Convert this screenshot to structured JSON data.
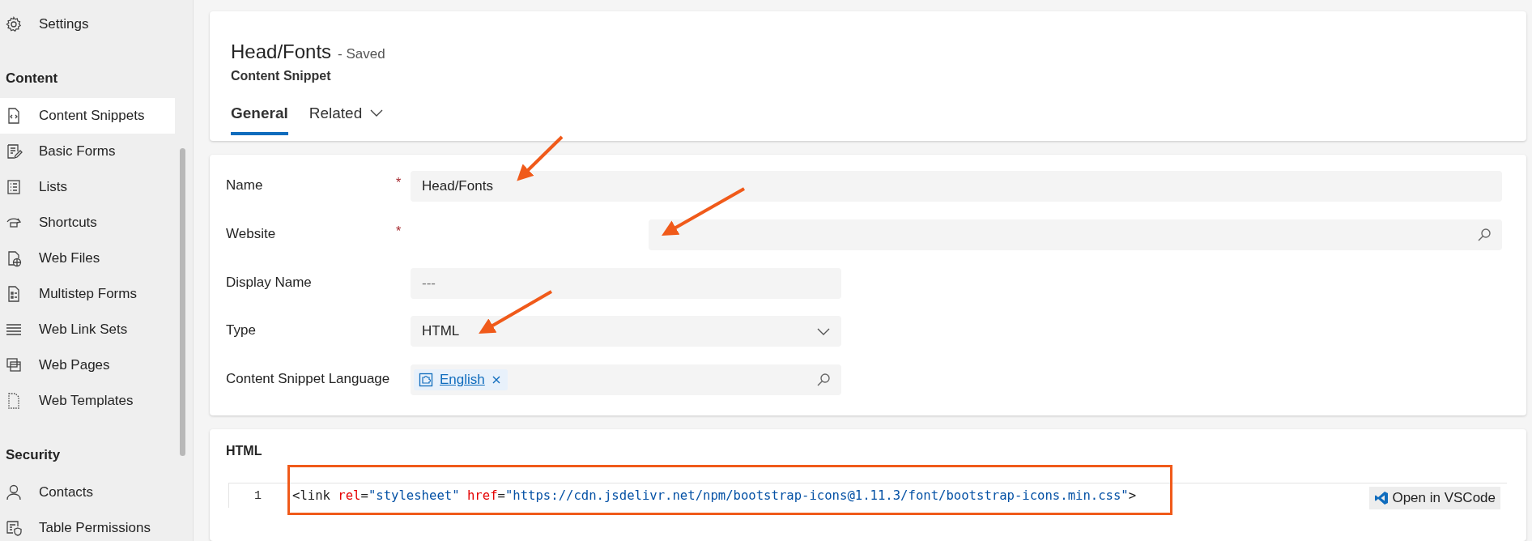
{
  "sidebar": {
    "items": [
      {
        "kind": "item",
        "label": "Settings",
        "selected": false
      },
      {
        "kind": "header",
        "label": "Content"
      },
      {
        "kind": "item",
        "label": "Content Snippets",
        "selected": true
      },
      {
        "kind": "item",
        "label": "Basic Forms",
        "selected": false
      },
      {
        "kind": "item",
        "label": "Lists",
        "selected": false
      },
      {
        "kind": "item",
        "label": "Shortcuts",
        "selected": false
      },
      {
        "kind": "item",
        "label": "Web Files",
        "selected": false
      },
      {
        "kind": "item",
        "label": "Multistep Forms",
        "selected": false
      },
      {
        "kind": "item",
        "label": "Web Link Sets",
        "selected": false
      },
      {
        "kind": "item",
        "label": "Web Pages",
        "selected": false
      },
      {
        "kind": "item",
        "label": "Web Templates",
        "selected": false
      },
      {
        "kind": "header",
        "label": "Security"
      },
      {
        "kind": "item",
        "label": "Contacts",
        "selected": false
      },
      {
        "kind": "item",
        "label": "Table Permissions",
        "selected": false
      }
    ]
  },
  "header": {
    "title": "Head/Fonts",
    "status": "- Saved",
    "entity": "Content Snippet",
    "tabs": [
      {
        "label": "General",
        "selected": true,
        "dropdown": false
      },
      {
        "label": "Related",
        "selected": false,
        "dropdown": true
      }
    ]
  },
  "form": {
    "fields": [
      {
        "kind": "text",
        "label": "Name",
        "required_mark": "*",
        "value": "Head/Fonts"
      },
      {
        "kind": "lookup",
        "label": "Website",
        "required_mark": "*"
      },
      {
        "kind": "text",
        "label": "Display Name",
        "placeholder": "---"
      },
      {
        "kind": "select",
        "label": "Type",
        "value": "HTML"
      },
      {
        "kind": "lookup",
        "label": "Content Snippet Language",
        "tag": "English"
      }
    ]
  },
  "html_section": {
    "title": "HTML",
    "lines": [
      {
        "number": "1",
        "tokens": [
          {
            "kind": "plain",
            "text": "<link "
          },
          {
            "kind": "attr",
            "text": "rel"
          },
          {
            "kind": "plain",
            "text": "="
          },
          {
            "kind": "string",
            "text": "\"stylesheet\""
          },
          {
            "kind": "attr",
            "text": " href"
          },
          {
            "kind": "plain",
            "text": "="
          },
          {
            "kind": "string",
            "text": "\"https://cdn.jsdelivr.net/npm/bootstrap-icons@1.11.3/font/bootstrap-icons.min.css\""
          },
          {
            "kind": "plain",
            "text": ">"
          }
        ]
      }
    ],
    "button": "Open in VSCode"
  }
}
